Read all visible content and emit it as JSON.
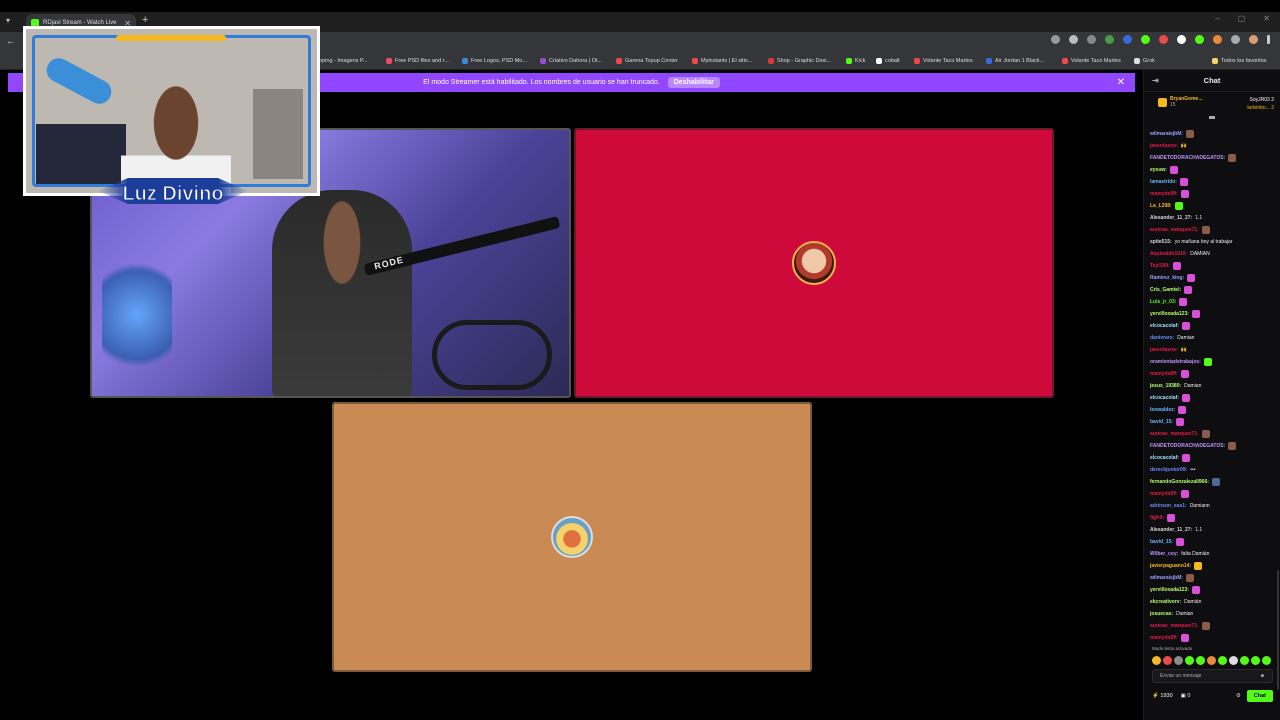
{
  "browser": {
    "tab_title": "RDjavi Stream - Watch Live",
    "new_tab": "+",
    "bookmarks": [
      "Free PSD files and r...",
      "Free Logos, PSD Mo...",
      "Criativo Dahora | Ot...",
      "Garena Topup Center",
      "Myinstants | El sitio...",
      "Shop - Graphic Desi...",
      "Kick",
      "cobalt",
      "Volante Taco Martes",
      "Air Jordan 1 Black...",
      "Volante Taco Martes",
      "Grok"
    ],
    "bookmark_partial": "ooping - Imagens P...",
    "all_favorites": "Todos los favoritos"
  },
  "banner": {
    "text": "El modo Streamer está habilitado. Los nombres de usuario se han truncado.",
    "button": "Deshabilitar",
    "close": "✕"
  },
  "overlay": {
    "logo_text": "Luz Divino"
  },
  "cam": {
    "mic_label": "RODE"
  },
  "colors": {
    "kick_green": "#53fc18",
    "banner_purple": "#9147ff",
    "tile_red": "#ce0a3a",
    "tile_tan": "#c98a53"
  },
  "chat": {
    "title": "Chat",
    "leaders": {
      "top_name": "BryanGome...",
      "top_sub": "15",
      "right_1": "SoyJR03",
      "right_1_count": "2",
      "right_2": "kelvinbo...",
      "right_2_count": "2"
    },
    "messages": [
      {
        "user": "wilmaraisjbM:",
        "text": "",
        "color": "#9aa0ff",
        "emote": "#8a5a4a"
      },
      {
        "user": "jaserdasne:",
        "text": "🙌",
        "color": "#e9194c",
        "emote": ""
      },
      {
        "user": "FANDETODORACHADEGATOS:",
        "text": "",
        "color": "#bf94ff",
        "emote": "#8a5a4a"
      },
      {
        "user": "eysuw:",
        "text": "",
        "color": "#b7ff6a",
        "emote": "#d84fd8"
      },
      {
        "user": "lamastrido:",
        "text": "",
        "color": "#6ab7ff",
        "emote": "#d84fd8"
      },
      {
        "user": "mamyds99:",
        "text": "",
        "color": "#e9194c",
        "emote": "#d84fd8"
      },
      {
        "user": "La_L298:",
        "text": "",
        "color": "#f5b820",
        "emote": "#53fc18"
      },
      {
        "user": "Alexander_11_27:",
        "text": "1.1",
        "color": "#d8d8d8",
        "emote": ""
      },
      {
        "user": "aurinas_marques71:",
        "text": "",
        "color": "#e9194c",
        "emote": "#8a5a4a"
      },
      {
        "user": "spite515:",
        "text": "yo mañana boy al trabajar",
        "color": "#d8d8d8",
        "emote": ""
      },
      {
        "user": "Aquinaldo1010:",
        "text": "DAMIAN",
        "color": "#e9194c",
        "emote": ""
      },
      {
        "user": "Tayl199:",
        "text": "",
        "color": "#e9194c",
        "emote": "#d84fd8"
      },
      {
        "user": "Ramirez_king:",
        "text": "",
        "color": "#9aa0ff",
        "emote": "#d84fd8"
      },
      {
        "user": "Cris_Gamtel:",
        "text": "",
        "color": "#b7ff6a",
        "emote": "#d84fd8"
      },
      {
        "user": "Luis_jr_03:",
        "text": "",
        "color": "#53fc18",
        "emote": "#d84fd8"
      },
      {
        "user": "yervilloxada123:",
        "text": "",
        "color": "#b7ff6a",
        "emote": "#d84fd8"
      },
      {
        "user": "elcocacolaf:",
        "text": "",
        "color": "#9ae0ff",
        "emote": "#d84fd8"
      },
      {
        "user": "danivrars:",
        "text": "Damian",
        "color": "#6a8aff",
        "emote": ""
      },
      {
        "user": "jaserdasne:",
        "text": "🙌",
        "color": "#e9194c",
        "emote": ""
      },
      {
        "user": "oramientadetrabajos:",
        "text": "",
        "color": "#bf94ff",
        "emote": "#53fc18"
      },
      {
        "user": "mamyds99:",
        "text": "",
        "color": "#e9194c",
        "emote": "#d84fd8"
      },
      {
        "user": "jesus_19380:",
        "text": "Damian",
        "color": "#b7ff6a",
        "emote": ""
      },
      {
        "user": "elcocacolaf:",
        "text": "",
        "color": "#9ae0ff",
        "emote": "#d84fd8"
      },
      {
        "user": "leowaldez:",
        "text": "",
        "color": "#6ab7ff",
        "emote": "#d84fd8"
      },
      {
        "user": "bavid_15:",
        "text": "",
        "color": "#6ab7ff",
        "emote": "#d84fd8"
      },
      {
        "user": "aurinas_marques71:",
        "text": "",
        "color": "#e9194c",
        "emote": "#8a5a4a"
      },
      {
        "user": "FANDETODORACHADEGATOS:",
        "text": "",
        "color": "#bf94ff",
        "emote": "#8a5a4a"
      },
      {
        "user": "elcocacolaf:",
        "text": "",
        "color": "#9ae0ff",
        "emote": "#d84fd8"
      },
      {
        "user": "dereckjunior09:",
        "text": "•••",
        "color": "#6a8aff",
        "emote": ""
      },
      {
        "user": "fernandoGonzalezall966:",
        "text": "",
        "color": "#b7ff6a",
        "emote": "#4a6a9a"
      },
      {
        "user": "mamyds99:",
        "text": "",
        "color": "#e9194c",
        "emote": "#d84fd8"
      },
      {
        "user": "adrinson_eas1:",
        "text": "Damiann",
        "color": "#6a8aff",
        "emote": ""
      },
      {
        "user": "figfr9:",
        "text": "",
        "color": "#e9194c",
        "emote": "#d84fd8"
      },
      {
        "user": "Alexander_11_27:",
        "text": "1.1",
        "color": "#d8d8d8",
        "emote": ""
      },
      {
        "user": "bavid_15:",
        "text": "",
        "color": "#6ab7ff",
        "emote": "#d84fd8"
      },
      {
        "user": "Wilber_coy:",
        "text": "falta Damián",
        "color": "#bf94ff",
        "emote": ""
      },
      {
        "user": "javierpaguano14:",
        "text": "",
        "color": "#f5b820",
        "emote": "#f5b820"
      },
      {
        "user": "wilmaraisjbM:",
        "text": "",
        "color": "#9aa0ff",
        "emote": "#8a5a4a"
      },
      {
        "user": "yervilloxada123:",
        "text": "",
        "color": "#b7ff6a",
        "emote": "#d84fd8"
      },
      {
        "user": "ekcreativorv:",
        "text": "Damián",
        "color": "#b7ff6a",
        "emote": ""
      },
      {
        "user": "josuecas:",
        "text": "Damian",
        "color": "#b7ff6a",
        "emote": ""
      },
      {
        "user": "aurinas_marques71:",
        "text": "",
        "color": "#e9194c",
        "emote": "#8a5a4a"
      },
      {
        "user": "mamyds99:",
        "text": "",
        "color": "#e9194c",
        "emote": "#d84fd8"
      }
    ],
    "mode_note": "Modo lento activado",
    "input_placeholder": "Enviar un mensaje",
    "viewers": "1930",
    "followers": "0",
    "send_button": "Chat"
  }
}
